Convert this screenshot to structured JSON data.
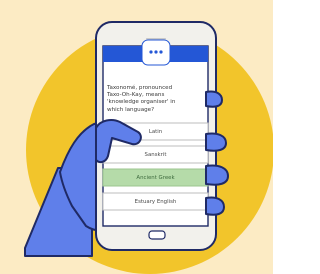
{
  "quiz": {
    "question": "Taxonomé, pronounced\nTaxo-Oh-Kay, means\n'knowledge organiser' in\nwhich language?",
    "answers": [
      {
        "label": "Latin",
        "state": "default"
      },
      {
        "label": "Sanskrit",
        "state": "default"
      },
      {
        "label": "Ancient Greek",
        "state": "highlighted"
      },
      {
        "label": "Estuary English",
        "state": "default"
      }
    ]
  },
  "colors": {
    "background": "#FCEBC4",
    "circle": "#F2C52B",
    "hand": "#5F7FEA",
    "phone_body": "#F2F1EC",
    "phone_screen": "#FFFFFF",
    "header_blue": "#2457D6",
    "answer_border": "#BDBDBD",
    "answer_correct": "#B5DBA9"
  },
  "icons": {
    "header_dots": "three-dots-icon",
    "home_button": "home-button-icon"
  }
}
